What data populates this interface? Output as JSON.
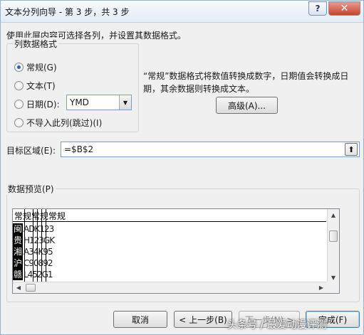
{
  "window": {
    "title": "文本分列向导 - 第 3 步，共 3 步",
    "help": "?",
    "close": "✕"
  },
  "instructions": "使用此屏内容可选择各列，并设置其数据格式。",
  "column_format": {
    "legend": "列数据格式",
    "options": [
      {
        "label": "常规(G)",
        "checked": true
      },
      {
        "label": "文本(T)",
        "checked": false
      },
      {
        "label": "日期(D):",
        "checked": false
      },
      {
        "label": "不导入此列(跳过)(I)",
        "checked": false
      }
    ],
    "date_format": "YMD"
  },
  "description": "“常规”数据格式将数值转换成数字，日期值会转换成日期，其余数据则转换成文本。",
  "advanced_button": "高级(A)...",
  "target": {
    "label": "目标区域(E):",
    "value": "=$B$2",
    "collapse_icon": "⬆"
  },
  "preview": {
    "label": "数据预览(P)",
    "header": "常规常规常规",
    "rows": [
      {
        "c1": "闽",
        "c2": "ADK123"
      },
      {
        "c1": "贵",
        "c2": "H123GK"
      },
      {
        "c1": "湘",
        "c2": "A34K95"
      },
      {
        "c1": "沪",
        "c2": "C90892"
      },
      {
        "c1": "赣",
        "c2": "L452G1"
      }
    ]
  },
  "buttons": {
    "cancel": "取消",
    "back": "< 上一步(B)",
    "next": "下一步(N) >",
    "finish": "完成(F)"
  },
  "watermark": "头条号 / 最爱动漫评测"
}
